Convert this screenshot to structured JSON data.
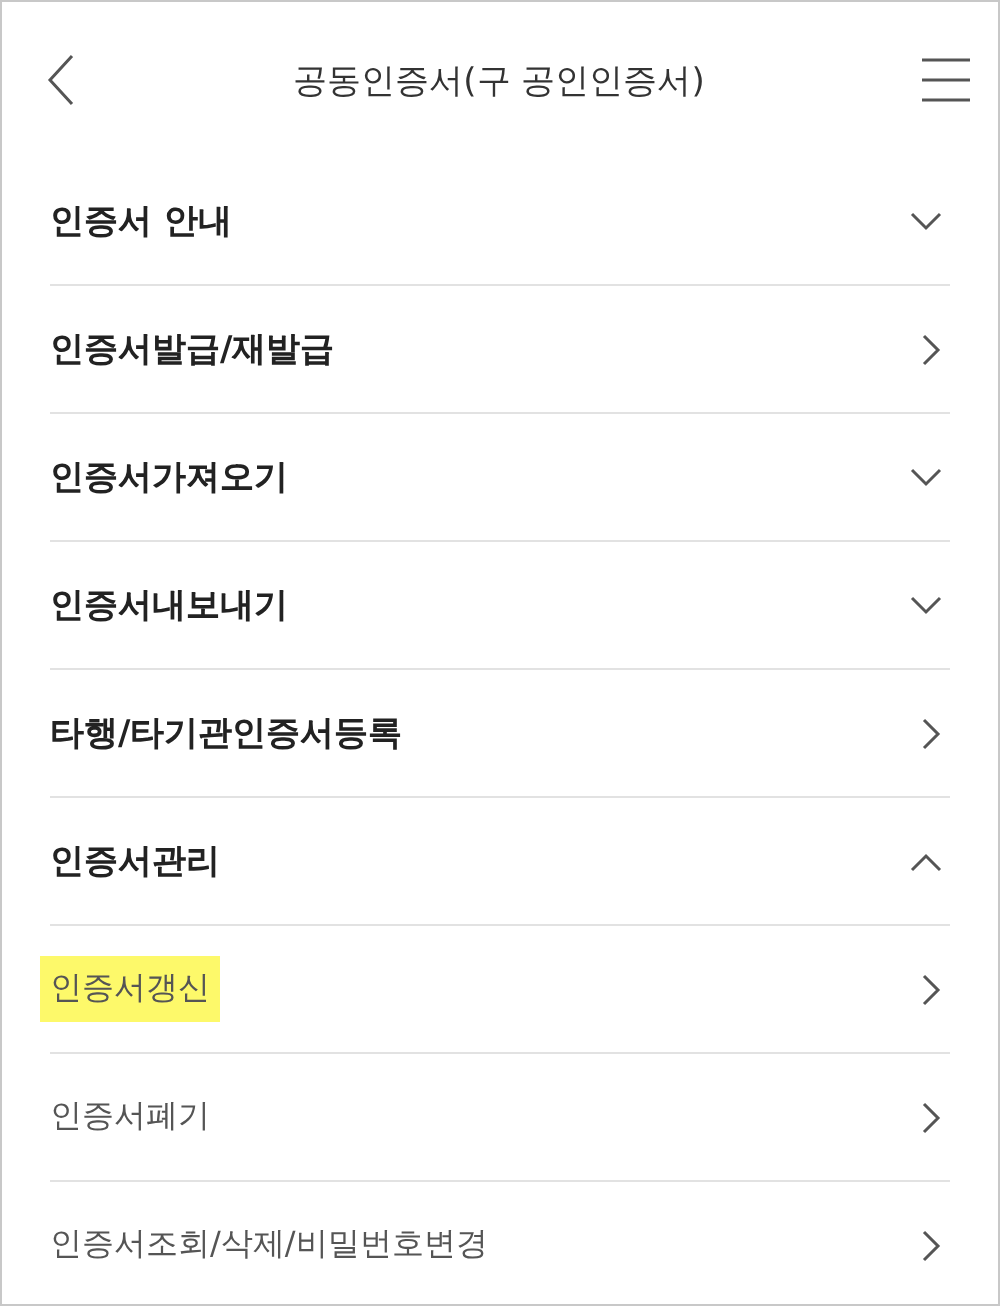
{
  "header": {
    "title": "공동인증서(구 공인인증서)"
  },
  "menu": [
    {
      "label": "인증서 안내",
      "kind": "toggle",
      "expanded": false
    },
    {
      "label": "인증서발급/재발급",
      "kind": "link"
    },
    {
      "label": "인증서가져오기",
      "kind": "toggle",
      "expanded": false
    },
    {
      "label": "인증서내보내기",
      "kind": "toggle",
      "expanded": false
    },
    {
      "label": "타행/타기관인증서등록",
      "kind": "link"
    },
    {
      "label": "인증서관리",
      "kind": "toggle",
      "expanded": true,
      "children": [
        {
          "label": "인증서갱신",
          "highlighted": true
        },
        {
          "label": "인증서폐기",
          "highlighted": false
        },
        {
          "label": "인증서조회/삭제/비밀번호변경",
          "highlighted": false
        }
      ]
    }
  ]
}
